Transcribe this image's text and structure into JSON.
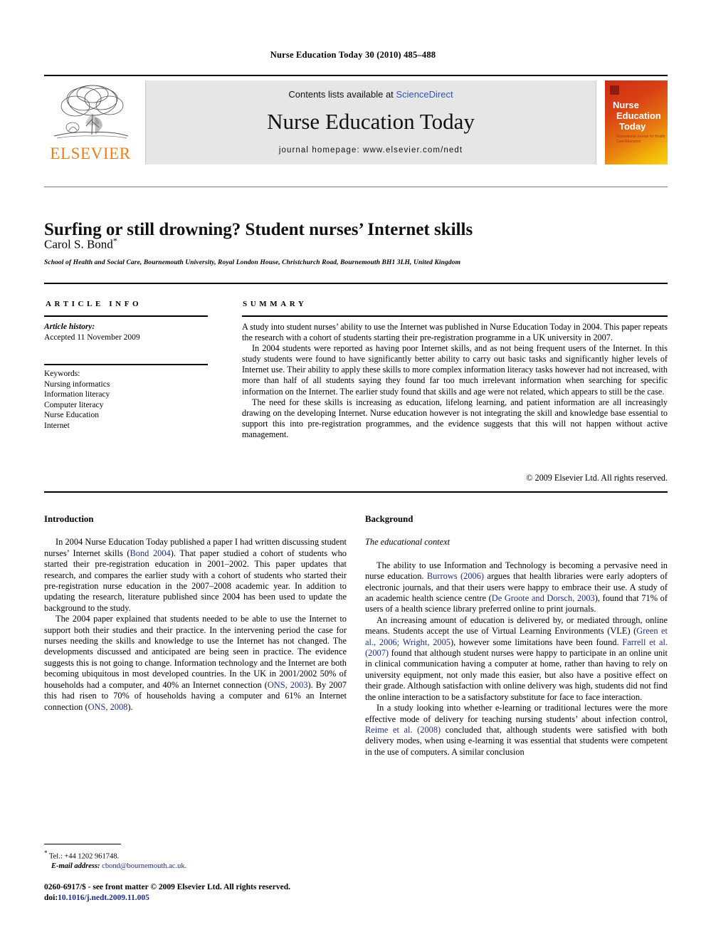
{
  "running_head": "Nurse Education Today 30 (2010) 485–488",
  "masthead": {
    "contents_prefix": "Contents lists available at ",
    "sciencedirect": "ScienceDirect",
    "journal_title": "Nurse Education Today",
    "homepage": "journal homepage: www.elsevier.com/nedt",
    "publisher_name": "ELSEVIER",
    "cover": {
      "line1": "Nurse",
      "line2": "Education",
      "line3": "Today",
      "subtitle": "International Journal for Health Care Education"
    },
    "colors": {
      "link_blue": "#3355bb",
      "elsevier_orange": "#f07d1a",
      "band_gray": "#e6e6e6"
    }
  },
  "title_block": {
    "title": "Surfing or still drowning? Student nurses’ Internet skills",
    "author": "Carol S. Bond",
    "author_marker": "*",
    "affiliation": "School of Health and Social Care, Bournemouth University, Royal London House, Christchurch Road, Bournemouth BH1 3LH, United Kingdom"
  },
  "article_info": {
    "label": "ARTICLE INFO",
    "history_label": "Article history:",
    "history_value": "Accepted 11 November 2009",
    "keywords_label": "Keywords:",
    "keywords": [
      "Nursing informatics",
      "Information literacy",
      "Computer literacy",
      "Nurse Education",
      "Internet"
    ]
  },
  "summary": {
    "label": "SUMMARY",
    "paragraphs": [
      "A study into student nurses’ ability to use the Internet was published in Nurse Education Today in 2004. This paper repeats the research with a cohort of students starting their pre-registration programme in a UK university in 2007.",
      "In 2004 students were reported as having poor Internet skills, and as not being frequent users of the Internet. In this study students were found to have significantly better ability to carry out basic tasks and significantly higher levels of Internet use. Their ability to apply these skills to more complex information literacy tasks however had not increased, with more than half of all students saying they found far too much irrelevant information when searching for specific information on the Internet. The earlier study found that skills and age were not related, which appears to still be the case.",
      "The need for these skills is increasing as education, lifelong learning, and patient information are all increasingly drawing on the developing Internet. Nurse education however is not integrating the skill and knowledge base essential to support this into pre-registration programmes, and the evidence suggests that this will not happen without active management."
    ],
    "copyright": "© 2009 Elsevier Ltd. All rights reserved."
  },
  "body": {
    "left": {
      "heading": "Introduction",
      "paragraphs": [
        {
          "segments": [
            {
              "t": "In 2004 Nurse Education Today published a paper I had written discussing student nurses’ Internet skills (",
              "cite": false
            },
            {
              "t": "Bond 2004",
              "cite": true
            },
            {
              "t": "). That paper studied a cohort of students who started their pre-registration education in 2001–2002. This paper updates that research, and compares the earlier study with a cohort of students who started their pre-registration nurse education in the 2007–2008 academic year. In addition to updating the research, literature published since 2004 has been used to update the background to the study.",
              "cite": false
            }
          ]
        },
        {
          "segments": [
            {
              "t": "The 2004 paper explained that students needed to be able to use the Internet to support both their studies and their practice. In the intervening period the case for nurses needing the skills and knowledge to use the Internet has not changed. The developments discussed and anticipated are being seen in practice. The evidence suggests this is not going to change. Information technology and the Internet are both becoming ubiquitous in most developed countries. In the UK in 2001/2002 50% of households had a computer, and 40% an Internet connection (",
              "cite": false
            },
            {
              "t": "ONS, 2003",
              "cite": true
            },
            {
              "t": "). By 2007 this had risen to 70% of households having a computer and 61% an Internet connection (",
              "cite": false
            },
            {
              "t": "ONS, 2008",
              "cite": true
            },
            {
              "t": ").",
              "cite": false
            }
          ]
        }
      ]
    },
    "right": {
      "heading": "Background",
      "subheading": "The educational context",
      "paragraphs": [
        {
          "segments": [
            {
              "t": "The ability to use Information and Technology is becoming a pervasive need in nurse education. ",
              "cite": false
            },
            {
              "t": "Burrows (2006)",
              "cite": true
            },
            {
              "t": " argues that health libraries were early adopters of electronic journals, and that their users were happy to embrace their use. A study of an academic health science centre (",
              "cite": false
            },
            {
              "t": "De Groote and Dorsch, 2003",
              "cite": true
            },
            {
              "t": "), found that 71% of users of a health science library preferred online to print journals.",
              "cite": false
            }
          ]
        },
        {
          "segments": [
            {
              "t": "An increasing amount of education is delivered by, or mediated through, online means. Students accept the use of Virtual Learning Environments (VLE) (",
              "cite": false
            },
            {
              "t": "Green et al., 2006; Wright, 2005",
              "cite": true
            },
            {
              "t": "), however some limitations have been found. ",
              "cite": false
            },
            {
              "t": "Farrell et al. (2007)",
              "cite": true
            },
            {
              "t": " found that although student nurses were happy to participate in an online unit in clinical communication having a computer at home, rather than having to rely on university equipment, not only made this easier, but also have a positive effect on their grade. Although satisfaction with online delivery was high, students did not find the online interaction to be a satisfactory substitute for face to face interaction.",
              "cite": false
            }
          ]
        },
        {
          "segments": [
            {
              "t": "In a study looking into whether e-learning or traditional lectures were the more effective mode of delivery for teaching nursing students’ about infection control, ",
              "cite": false
            },
            {
              "t": "Reime et al. (2008)",
              "cite": true
            },
            {
              "t": " concluded that, although students were satisfied with both delivery modes, when using e-learning it was essential that students were competent in the use of computers. A similar conclusion",
              "cite": false
            }
          ]
        }
      ]
    }
  },
  "footnote": {
    "marker": "*",
    "tel": "Tel.: +44 1202 961748.",
    "email_label": "E-mail address:",
    "email": "cbond@bournemouth.ac.uk."
  },
  "footer": {
    "issn_line": "0260-6917/$ - see front matter © 2009 Elsevier Ltd. All rights reserved.",
    "doi_label": "doi:",
    "doi_value": "10.1016/j.nedt.2009.11.005"
  }
}
